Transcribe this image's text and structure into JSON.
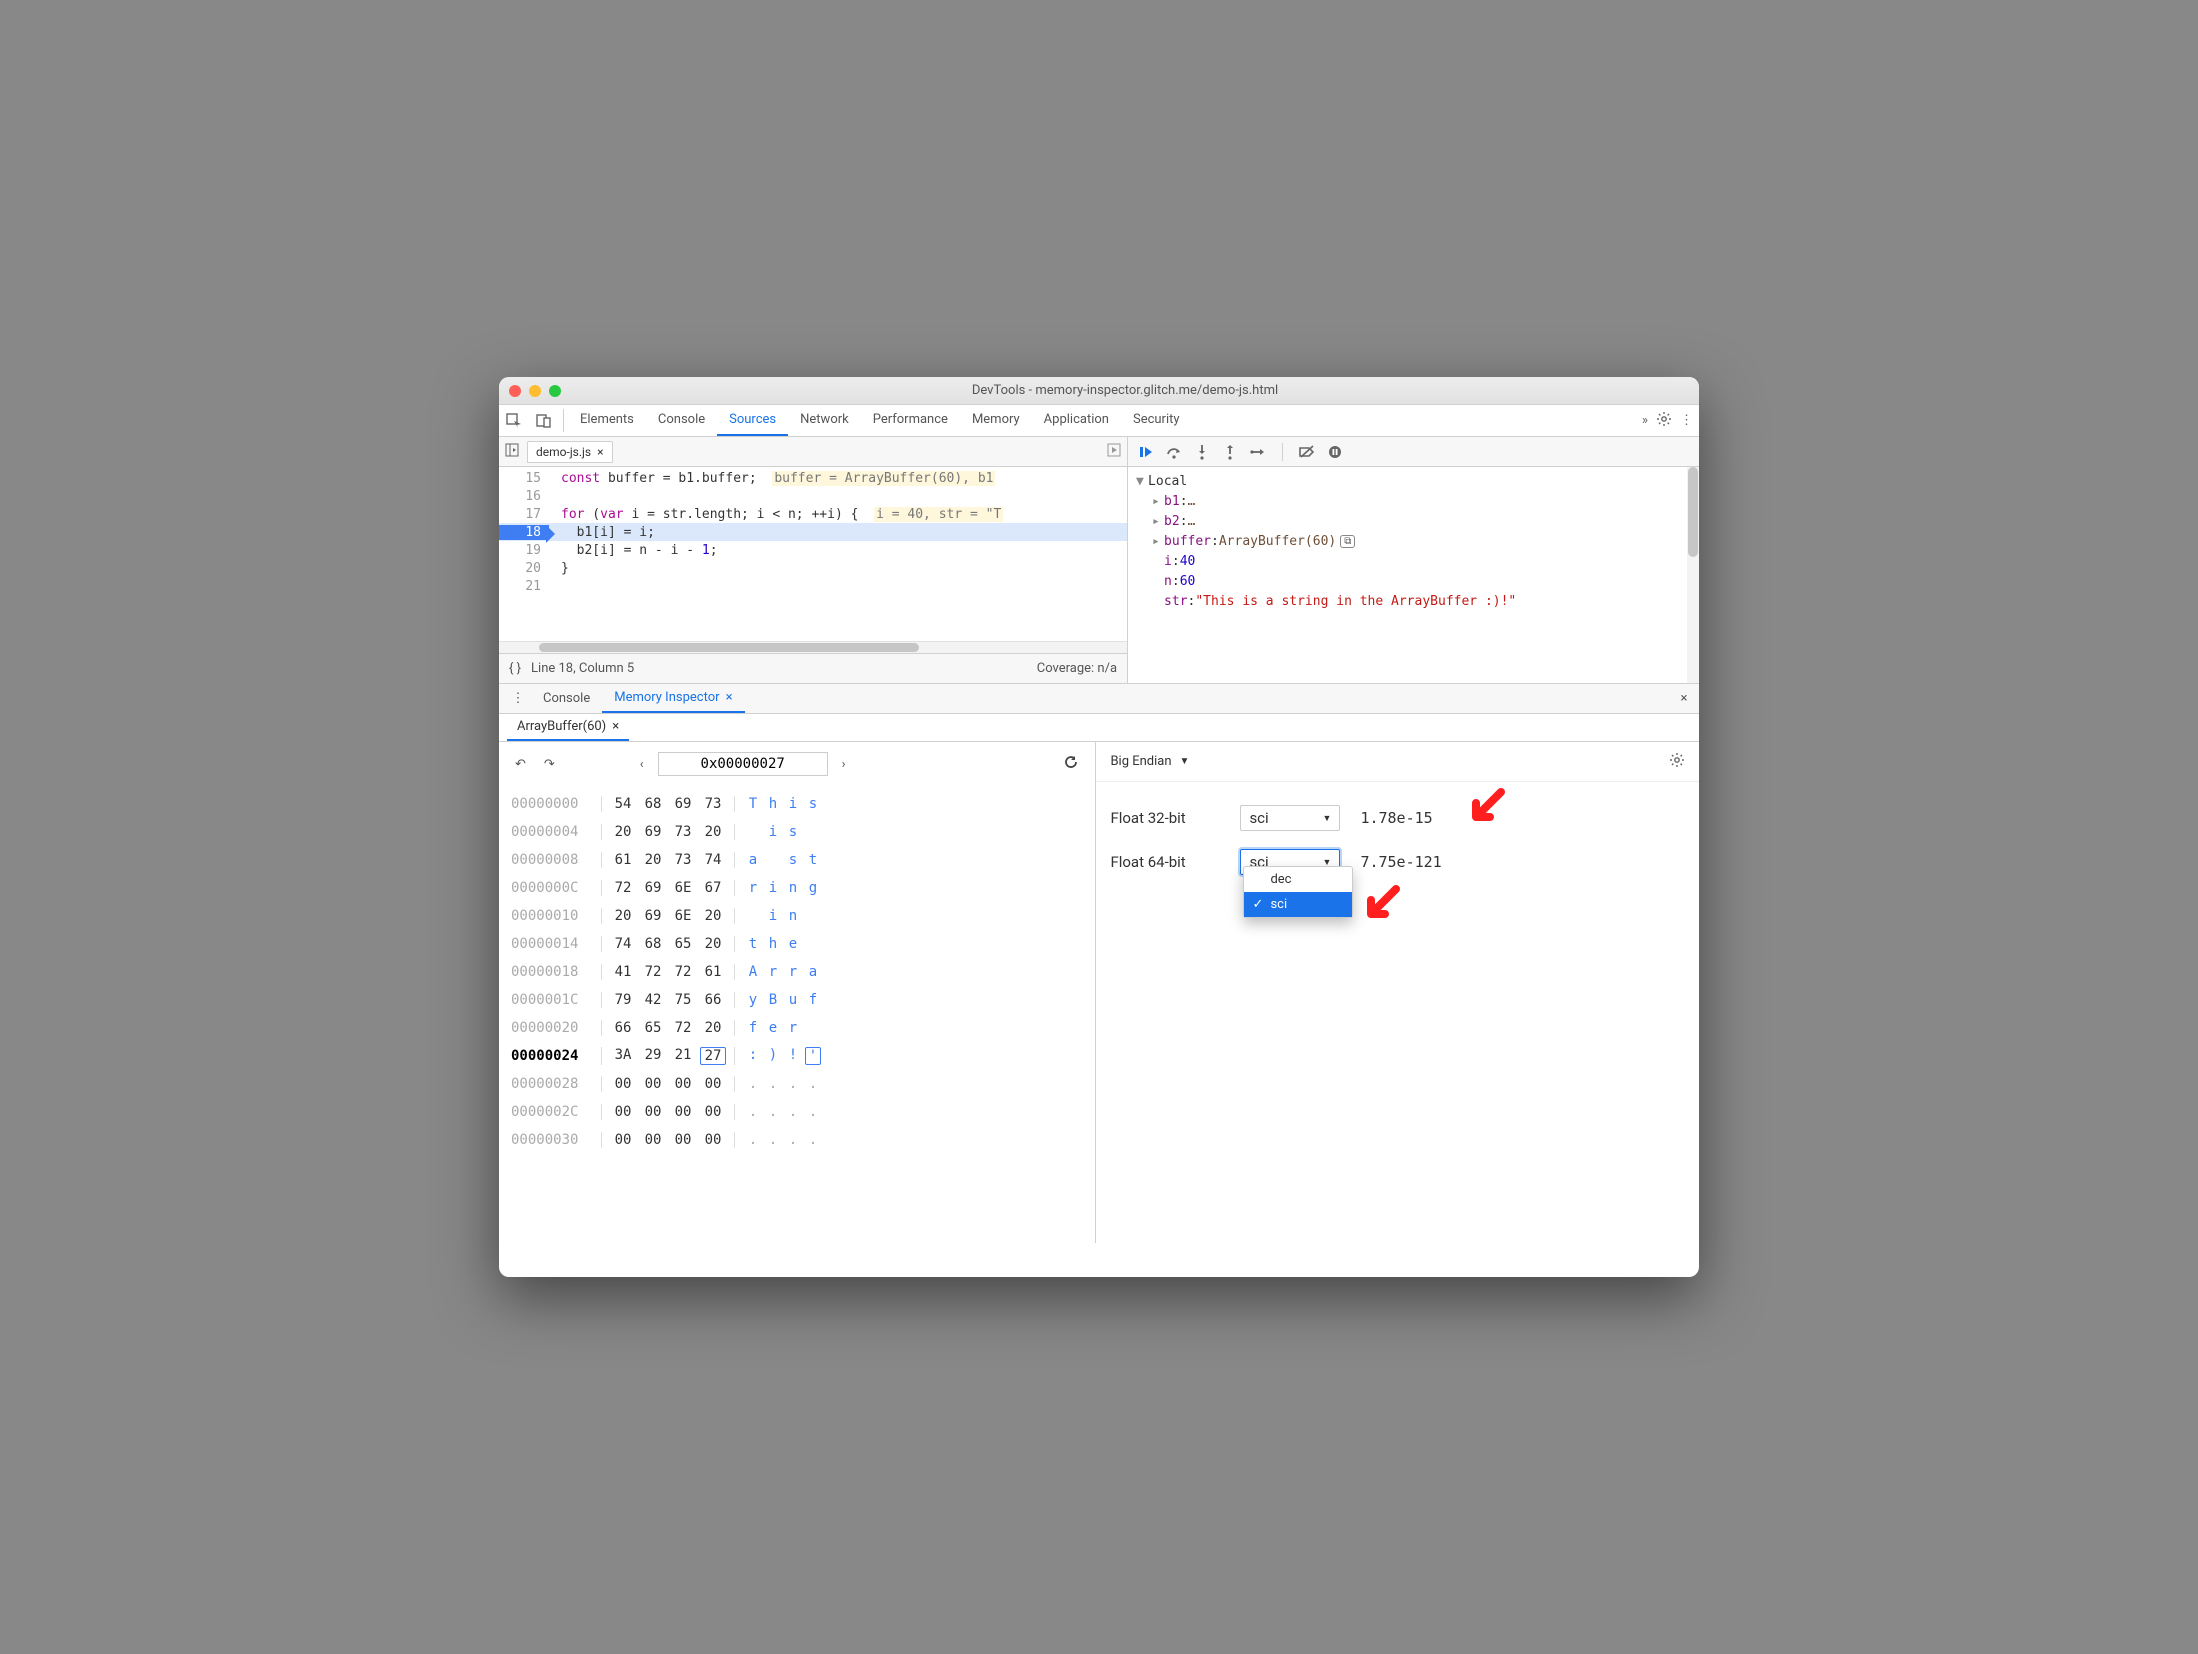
{
  "window": {
    "title": "DevTools - memory-inspector.glitch.me/demo-js.html"
  },
  "main_tabs": [
    "Elements",
    "Console",
    "Sources",
    "Network",
    "Performance",
    "Memory",
    "Application",
    "Security"
  ],
  "main_active_tab": "Sources",
  "file": {
    "name": "demo-js.js"
  },
  "code": {
    "lines": [
      {
        "n": 15,
        "bp": false,
        "html": "<span class='kw'>const</span> buffer = b1.buffer;  <span class='hint'>buffer = ArrayBuffer(60), b1</span>"
      },
      {
        "n": 16,
        "bp": false,
        "html": ""
      },
      {
        "n": 17,
        "bp": false,
        "html": "<span class='kw'>for</span> (<span class='kw'>var</span> i = str.length; i &lt; n; ++i) {  <span class='hint'>i = 40, str = \"T</span>"
      },
      {
        "n": 18,
        "bp": true,
        "html": "  b1[i] = i;"
      },
      {
        "n": 19,
        "bp": false,
        "html": "  b2[i] = n - i - <span class='num'>1</span>;"
      },
      {
        "n": 20,
        "bp": false,
        "html": "}"
      },
      {
        "n": 21,
        "bp": false,
        "html": ""
      }
    ]
  },
  "status": {
    "pos": "Line 18, Column 5",
    "coverage": "Coverage: n/a"
  },
  "scope": {
    "title": "Local",
    "rows": [
      {
        "expand": "▸",
        "name": "b1",
        "val": "…"
      },
      {
        "expand": "▸",
        "name": "b2",
        "val": "…"
      },
      {
        "expand": "▸",
        "name": "buffer",
        "val": "ArrayBuffer(60)",
        "hex": true
      },
      {
        "expand": "",
        "name": "i",
        "val": "40",
        "num": true
      },
      {
        "expand": "",
        "name": "n",
        "val": "60",
        "num": true
      },
      {
        "expand": "",
        "name": "str",
        "val": "\"This is a string in the ArrayBuffer :)!\"",
        "str": true
      }
    ]
  },
  "drawer": {
    "tabs": [
      "Console",
      "Memory Inspector"
    ],
    "active": "Memory Inspector",
    "buffer_tab": "ArrayBuffer(60)"
  },
  "memory": {
    "address": "0x00000027",
    "endian": "Big Endian",
    "rows": [
      {
        "addr": "00000000",
        "b": [
          "54",
          "68",
          "69",
          "73"
        ],
        "a": [
          "T",
          "h",
          "i",
          "s"
        ]
      },
      {
        "addr": "00000004",
        "b": [
          "20",
          "69",
          "73",
          "20"
        ],
        "a": [
          " ",
          "i",
          "s",
          " "
        ]
      },
      {
        "addr": "00000008",
        "b": [
          "61",
          "20",
          "73",
          "74"
        ],
        "a": [
          "a",
          " ",
          "s",
          "t"
        ]
      },
      {
        "addr": "0000000C",
        "b": [
          "72",
          "69",
          "6E",
          "67"
        ],
        "a": [
          "r",
          "i",
          "n",
          "g"
        ]
      },
      {
        "addr": "00000010",
        "b": [
          "20",
          "69",
          "6E",
          "20"
        ],
        "a": [
          " ",
          "i",
          "n",
          " "
        ]
      },
      {
        "addr": "00000014",
        "b": [
          "74",
          "68",
          "65",
          "20"
        ],
        "a": [
          "t",
          "h",
          "e",
          " "
        ]
      },
      {
        "addr": "00000018",
        "b": [
          "41",
          "72",
          "72",
          "61"
        ],
        "a": [
          "A",
          "r",
          "r",
          "a"
        ]
      },
      {
        "addr": "0000001C",
        "b": [
          "79",
          "42",
          "75",
          "66"
        ],
        "a": [
          "y",
          "B",
          "u",
          "f"
        ]
      },
      {
        "addr": "00000020",
        "b": [
          "66",
          "65",
          "72",
          "20"
        ],
        "a": [
          "f",
          "e",
          "r",
          " "
        ]
      },
      {
        "addr": "00000024",
        "b": [
          "3A",
          "29",
          "21",
          "27"
        ],
        "a": [
          ":",
          ")",
          "!",
          "'"
        ],
        "hl": true,
        "sel": 3
      },
      {
        "addr": "00000028",
        "b": [
          "00",
          "00",
          "00",
          "00"
        ],
        "a": [
          ".",
          ".",
          ".",
          "."
        ]
      },
      {
        "addr": "0000002C",
        "b": [
          "00",
          "00",
          "00",
          "00"
        ],
        "a": [
          ".",
          ".",
          ".",
          "."
        ]
      },
      {
        "addr": "00000030",
        "b": [
          "00",
          "00",
          "00",
          "00"
        ],
        "a": [
          ".",
          ".",
          ".",
          "."
        ]
      }
    ]
  },
  "values": {
    "float32": {
      "label": "Float 32-bit",
      "mode": "sci",
      "value": "1.78e-15"
    },
    "float64": {
      "label": "Float 64-bit",
      "mode": "sci",
      "value": "7.75e-121"
    },
    "options": [
      "dec",
      "sci"
    ],
    "selected": "sci"
  }
}
